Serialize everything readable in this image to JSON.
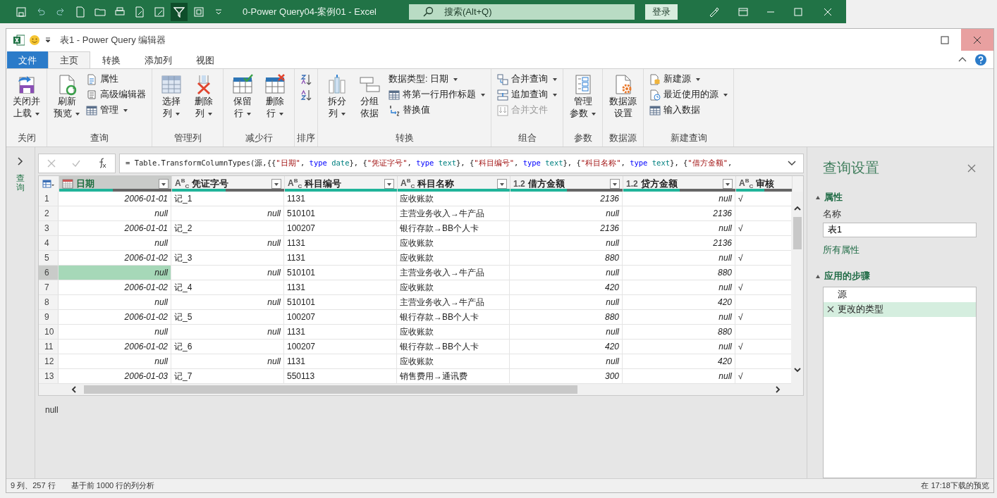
{
  "excel_bar": {
    "title": "0-Power Query04-案例01  -  Excel",
    "search": {
      "placeholder": "搜索(Alt+Q)"
    },
    "login_button": "登录"
  },
  "window": {
    "title": "表1 - Power Query 编辑器"
  },
  "tabs": [
    {
      "label": "文件",
      "kind": "file",
      "selected": false
    },
    {
      "label": "主页",
      "kind": "tab",
      "selected": true
    },
    {
      "label": "转换",
      "kind": "tab",
      "selected": false
    },
    {
      "label": "添加列",
      "kind": "tab",
      "selected": false
    },
    {
      "label": "视图",
      "kind": "tab",
      "selected": false
    }
  ],
  "ribbon": [
    {
      "label": "关闭",
      "buttons": [
        {
          "kind": "large",
          "lines": [
            "关闭并",
            "上载"
          ],
          "dropdown": true
        }
      ]
    },
    {
      "label": "查询",
      "buttons": [
        {
          "kind": "large",
          "lines": [
            "刷新",
            "预览"
          ],
          "dropdown": true
        },
        {
          "kind": "small",
          "label": "属性",
          "dropdown": false,
          "disabled": false
        },
        {
          "kind": "small",
          "label": "高级编辑器",
          "dropdown": false,
          "disabled": false
        },
        {
          "kind": "small",
          "label": "管理",
          "dropdown": true,
          "disabled": false
        }
      ]
    },
    {
      "label": "管理列",
      "buttons": [
        {
          "kind": "large",
          "lines": [
            "选择",
            "列"
          ],
          "dropdown": true
        },
        {
          "kind": "large",
          "lines": [
            "删除",
            "列"
          ],
          "dropdown": true
        }
      ]
    },
    {
      "label": "减少行",
      "buttons": [
        {
          "kind": "large",
          "lines": [
            "保留",
            "行"
          ],
          "dropdown": true
        },
        {
          "kind": "large",
          "lines": [
            "删除",
            "行"
          ],
          "dropdown": true
        }
      ]
    },
    {
      "label": "排序",
      "buttons": [
        {
          "kind": "icon"
        },
        {
          "kind": "icon"
        }
      ]
    },
    {
      "label": "转换",
      "buttons": [
        {
          "kind": "large",
          "lines": [
            "拆分",
            "列"
          ],
          "dropdown": true
        },
        {
          "kind": "large",
          "lines": [
            "分组",
            "依据"
          ],
          "dropdown": false
        },
        {
          "kind": "menu",
          "label": "数据类型: 日期",
          "dropdown": true,
          "disabled": false
        },
        {
          "kind": "small",
          "label": "将第一行用作标题",
          "dropdown": true,
          "disabled": false
        },
        {
          "kind": "small",
          "label": "替换值",
          "dropdown": false,
          "disabled": false
        }
      ]
    },
    {
      "label": "组合",
      "buttons": [
        {
          "kind": "small",
          "label": "合并查询",
          "dropdown": true,
          "disabled": false
        },
        {
          "kind": "small",
          "label": "追加查询",
          "dropdown": true,
          "disabled": false
        },
        {
          "kind": "small",
          "label": "合并文件",
          "dropdown": false,
          "disabled": true
        }
      ]
    },
    {
      "label": "参数",
      "buttons": [
        {
          "kind": "large",
          "lines": [
            "管理",
            "参数"
          ],
          "dropdown": true
        }
      ]
    },
    {
      "label": "数据源",
      "buttons": [
        {
          "kind": "large",
          "lines": [
            "数据源",
            "设置"
          ],
          "dropdown": false
        }
      ]
    },
    {
      "label": "新建查询",
      "buttons": [
        {
          "kind": "small",
          "label": "新建源",
          "dropdown": true,
          "disabled": false
        },
        {
          "kind": "small",
          "label": "最近使用的源",
          "dropdown": true,
          "disabled": false
        },
        {
          "kind": "small",
          "label": "输入数据",
          "dropdown": false,
          "disabled": false
        }
      ]
    }
  ],
  "queries_pane": {
    "label": "查询",
    "expanded": false
  },
  "formula": [
    {
      "text": "= Table.TransformColumnTypes(源,{{",
      "kind": "plain"
    },
    {
      "text": "\"日期\"",
      "kind": "string"
    },
    {
      "text": ", ",
      "kind": "plain"
    },
    {
      "text": "type",
      "kind": "keyword"
    },
    {
      "text": " date",
      "kind": "type"
    },
    {
      "text": "}, {",
      "kind": "plain"
    },
    {
      "text": "\"凭证字号\"",
      "kind": "string"
    },
    {
      "text": ", ",
      "kind": "plain"
    },
    {
      "text": "type",
      "kind": "keyword"
    },
    {
      "text": " text",
      "kind": "type"
    },
    {
      "text": "}, {",
      "kind": "plain"
    },
    {
      "text": "\"科目编号\"",
      "kind": "string"
    },
    {
      "text": ", ",
      "kind": "plain"
    },
    {
      "text": "type",
      "kind": "keyword"
    },
    {
      "text": " text",
      "kind": "type"
    },
    {
      "text": "}, {",
      "kind": "plain"
    },
    {
      "text": "\"科目名称\"",
      "kind": "string"
    },
    {
      "text": ", ",
      "kind": "plain"
    },
    {
      "text": "type",
      "kind": "keyword"
    },
    {
      "text": " text",
      "kind": "type"
    },
    {
      "text": "}, {",
      "kind": "plain"
    },
    {
      "text": "\"借方金额\"",
      "kind": "string"
    },
    {
      "text": ",",
      "kind": "plain"
    }
  ],
  "table": {
    "columns": [
      {
        "name": "日期",
        "kind": "date",
        "selected": true,
        "level": 0.48
      },
      {
        "name": "凭证字号",
        "kind": "text",
        "type_label": "A$^{B}$$_{C}$",
        "selected": false,
        "level": 0.48
      },
      {
        "name": "科目编号",
        "kind": "text",
        "type_label": "A$^{B}$$_{C}$",
        "selected": false,
        "level": 1
      },
      {
        "name": "科目名称",
        "kind": "text",
        "type_label": "A$^{B}$$_{C}$",
        "selected": false,
        "level": 1
      },
      {
        "name": "借方金额",
        "kind": "number",
        "type_label": "1.2",
        "selected": false,
        "level": 0.5
      },
      {
        "name": "贷方金额",
        "kind": "number",
        "type_label": "1.2",
        "selected": false,
        "level": 0.5
      },
      {
        "name": "审核",
        "kind": "text",
        "type_label": "A$^{B}$$_{C}$",
        "selected": false,
        "level": 0.5
      }
    ],
    "rows": [
      {
        "number": "1",
        "selected": false,
        "cells": [
          "2006-01-01",
          "记_1",
          "1131",
          "应收账款",
          "2136",
          {
            "value": "null",
            "kind": "null"
          },
          "√"
        ]
      },
      {
        "number": "2",
        "selected": false,
        "cells": [
          {
            "value": "null",
            "kind": "null"
          },
          {
            "value": "null",
            "kind": "null"
          },
          "510101",
          "主营业务收入→牛产品",
          {
            "value": "null",
            "kind": "null"
          },
          "2136",
          null
        ]
      },
      {
        "number": "3",
        "selected": false,
        "cells": [
          "2006-01-01",
          "记_2",
          "100207",
          "银行存款→BB个人卡",
          "2136",
          {
            "value": "null",
            "kind": "null"
          },
          "√"
        ]
      },
      {
        "number": "4",
        "selected": false,
        "cells": [
          {
            "value": "null",
            "kind": "null"
          },
          {
            "value": "null",
            "kind": "null"
          },
          "1131",
          "应收账款",
          {
            "value": "null",
            "kind": "null"
          },
          "2136",
          null
        ]
      },
      {
        "number": "5",
        "selected": false,
        "cells": [
          "2006-01-02",
          "记_3",
          "1131",
          "应收账款",
          "880",
          {
            "value": "null",
            "kind": "null"
          },
          "√"
        ]
      },
      {
        "number": "6",
        "selected": true,
        "cells": [
          {
            "value": "null",
            "kind": "null"
          },
          {
            "value": "null",
            "kind": "null"
          },
          "510101",
          "主营业务收入→牛产品",
          {
            "value": "null",
            "kind": "null"
          },
          "880",
          null
        ]
      },
      {
        "number": "7",
        "selected": false,
        "cells": [
          "2006-01-02",
          "记_4",
          "1131",
          "应收账款",
          "420",
          {
            "value": "null",
            "kind": "null"
          },
          "√"
        ]
      },
      {
        "number": "8",
        "selected": false,
        "cells": [
          {
            "value": "null",
            "kind": "null"
          },
          {
            "value": "null",
            "kind": "null"
          },
          "510101",
          "主营业务收入→牛产品",
          {
            "value": "null",
            "kind": "null"
          },
          "420",
          null
        ]
      },
      {
        "number": "9",
        "selected": false,
        "cells": [
          "2006-01-02",
          "记_5",
          "100207",
          "银行存款→BB个人卡",
          "880",
          {
            "value": "null",
            "kind": "null"
          },
          "√"
        ]
      },
      {
        "number": "10",
        "selected": false,
        "cells": [
          {
            "value": "null",
            "kind": "null"
          },
          {
            "value": "null",
            "kind": "null"
          },
          "1131",
          "应收账款",
          {
            "value": "null",
            "kind": "null"
          },
          "880",
          null
        ]
      },
      {
        "number": "11",
        "selected": false,
        "cells": [
          "2006-01-02",
          "记_6",
          "100207",
          "银行存款→BB个人卡",
          "420",
          {
            "value": "null",
            "kind": "null"
          },
          "√"
        ]
      },
      {
        "number": "12",
        "selected": false,
        "cells": [
          {
            "value": "null",
            "kind": "null"
          },
          {
            "value": "null",
            "kind": "null"
          },
          "1131",
          "应收账款",
          {
            "value": "null",
            "kind": "null"
          },
          "420",
          null
        ]
      },
      {
        "number": "13",
        "selected": false,
        "cells": [
          "2006-01-03",
          "记_7",
          "550113",
          "销售费用→通讯费",
          "300",
          {
            "value": "null",
            "kind": "null"
          },
          "√"
        ]
      }
    ]
  },
  "detail_pane": {
    "value": "null"
  },
  "query_settings": {
    "title": "查询设置",
    "sections": [
      {
        "title": "属性",
        "expanded": true,
        "kind": "properties",
        "name_label": "名称",
        "name_value": "表1",
        "link": "所有属性"
      },
      {
        "title": "应用的步骤",
        "expanded": true,
        "kind": "steps",
        "steps": [
          {
            "label": "源",
            "selected": false
          },
          {
            "label": "更改的类型",
            "selected": true
          }
        ]
      }
    ]
  },
  "status_bar": {
    "columns_rows": "9 列、257 行",
    "profiling": "基于前 1000 行的列分析",
    "preview": "在 17:18下载的预览"
  }
}
